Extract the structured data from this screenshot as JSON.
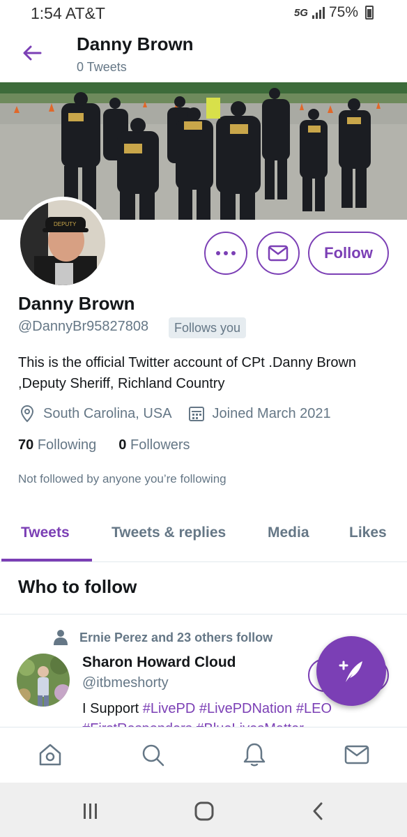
{
  "status_bar": {
    "time": "1:54 AT&T",
    "network": "5G",
    "battery": "75%"
  },
  "header": {
    "name": "Danny Brown",
    "tweet_count": "0 Tweets"
  },
  "profile": {
    "display_name": "Danny Brown",
    "handle": "@DannyBr95827808",
    "follows_you": "Follows you",
    "bio": "This is the official Twitter account of CPt .Danny Brown ,Deputy Sheriff, Richland Country",
    "location": "South Carolina, USA",
    "joined": "Joined March 2021",
    "following_count": "70",
    "following_label": "Following",
    "followers_count": "0",
    "followers_label": "Followers",
    "not_followed": "Not followed by anyone you’re following"
  },
  "actions": {
    "follow_label": "Follow"
  },
  "tabs": [
    {
      "label": "Tweets"
    },
    {
      "label": "Tweets & replies"
    },
    {
      "label": "Media"
    },
    {
      "label": "Likes"
    }
  ],
  "who_to_follow": {
    "title": "Who to follow",
    "social_context": "Ernie Perez and 23 others follow",
    "name": "Sharon Howard Cloud",
    "handle": "@itbmeshorty",
    "bio_prefix": "I Support ",
    "hashtags": [
      "#LivePD",
      "#LivePDNation",
      "#LEO"
    ],
    "bio_cutoff": "#FirstResponders #BlueLivesMatter"
  },
  "colors": {
    "accent": "#7b3fb5",
    "secondary_text": "#657786",
    "primary_text": "#14171a"
  },
  "icons": {
    "back": "arrow-left-icon",
    "more": "more-icon",
    "message": "envelope-icon",
    "location": "location-pin-icon",
    "calendar": "calendar-icon",
    "compose": "compose-icon",
    "home": "home-icon",
    "search": "search-icon",
    "notifications": "bell-icon",
    "messages": "mail-icon"
  }
}
